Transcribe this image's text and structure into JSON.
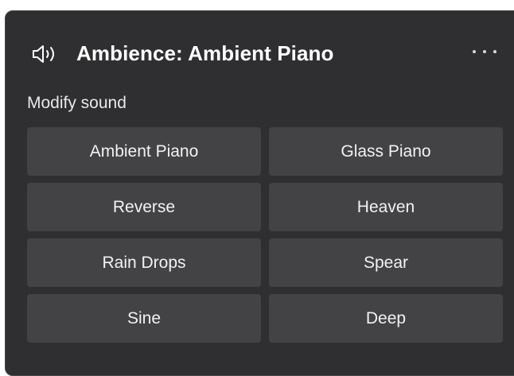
{
  "panel": {
    "title": "Ambience: Ambient Piano",
    "icon": "speaker-icon",
    "more_icon": "more-horizontal-icon"
  },
  "section": {
    "label": "Modify sound"
  },
  "sounds": [
    "Ambient Piano",
    "Glass Piano",
    "Reverse",
    "Heaven",
    "Rain Drops",
    "Spear",
    "Sine",
    "Deep"
  ],
  "colors": {
    "panel_background": "#2f2f31",
    "button_background": "#434346",
    "text": "#ffffff"
  }
}
